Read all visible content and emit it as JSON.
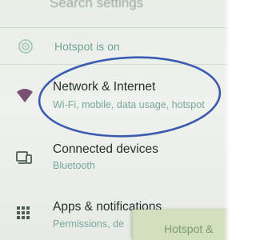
{
  "top": {
    "title": "Search settings"
  },
  "banner": {
    "text": "Hotspot is on",
    "icon": "hotspot-icon"
  },
  "items": [
    {
      "title": "Network & Internet",
      "subtitle": "Wi-Fi, mobile, data usage, hotspot",
      "icon": "wifi-icon"
    },
    {
      "title": "Connected devices",
      "subtitle": "Bluetooth",
      "icon": "devices-icon"
    },
    {
      "title": "Apps & notifications",
      "subtitle": "Permissions, de",
      "icon": "apps-grid-icon"
    }
  ],
  "overlay": {
    "text": "Hotspot &"
  },
  "colors": {
    "annotation": "#3b5bb0",
    "accent": "#6fa39a",
    "title": "#27302c"
  }
}
